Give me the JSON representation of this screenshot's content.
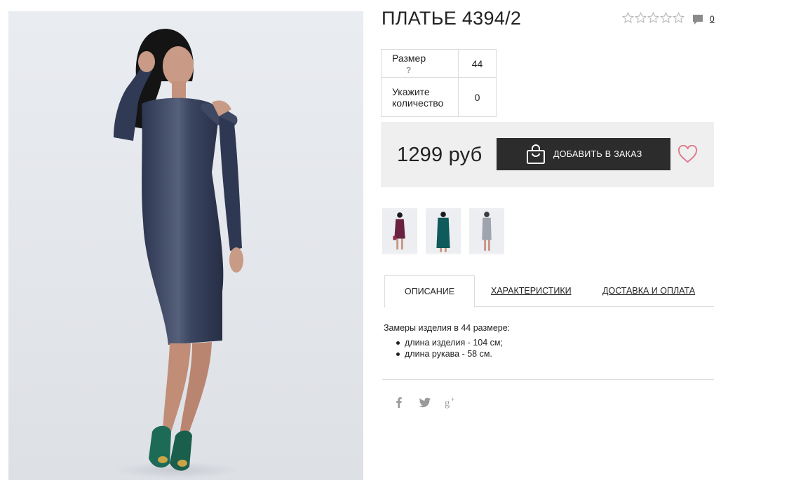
{
  "product": {
    "title": "ПЛАТЬЕ 4394/2",
    "rating_stars": 5,
    "rating_filled": 0,
    "comment_count": "0"
  },
  "options": {
    "size_label": "Размер",
    "size_help": "?",
    "size_value": "44",
    "qty_label_line1": "Укажите",
    "qty_label_line2": "количество",
    "qty_value": "0"
  },
  "purchase": {
    "price": "1299 руб",
    "add_button_label": "ДОБАВИТЬ В ЗАКАЗ",
    "button_color": "#2c2c2c",
    "heart_color": "#e07a8a"
  },
  "thumbnails": [
    {
      "icon": "wine-dress-thumbnail",
      "dress_color": "#6b2240"
    },
    {
      "icon": "teal-dress-thumbnail",
      "dress_color": "#0f5b5b"
    },
    {
      "icon": "grey-dress-thumbnail",
      "dress_color": "#9ea4ad"
    }
  ],
  "tabs": [
    {
      "label": "ОПИСАНИЕ",
      "active": true
    },
    {
      "label": "ХАРАКТЕРИСТИКИ",
      "active": false
    },
    {
      "label": "ДОСТАВКА И ОПЛАТА",
      "active": false
    }
  ],
  "description": {
    "intro": "Замеры изделия в 44 размере:",
    "items": [
      "длина изделия - 104 см;",
      "длина рукава - 58 см."
    ]
  },
  "social": [
    {
      "icon": "facebook-icon",
      "glyph": "f"
    },
    {
      "icon": "twitter-icon",
      "glyph": "t"
    },
    {
      "icon": "google-plus-icon",
      "glyph": "g+"
    }
  ]
}
